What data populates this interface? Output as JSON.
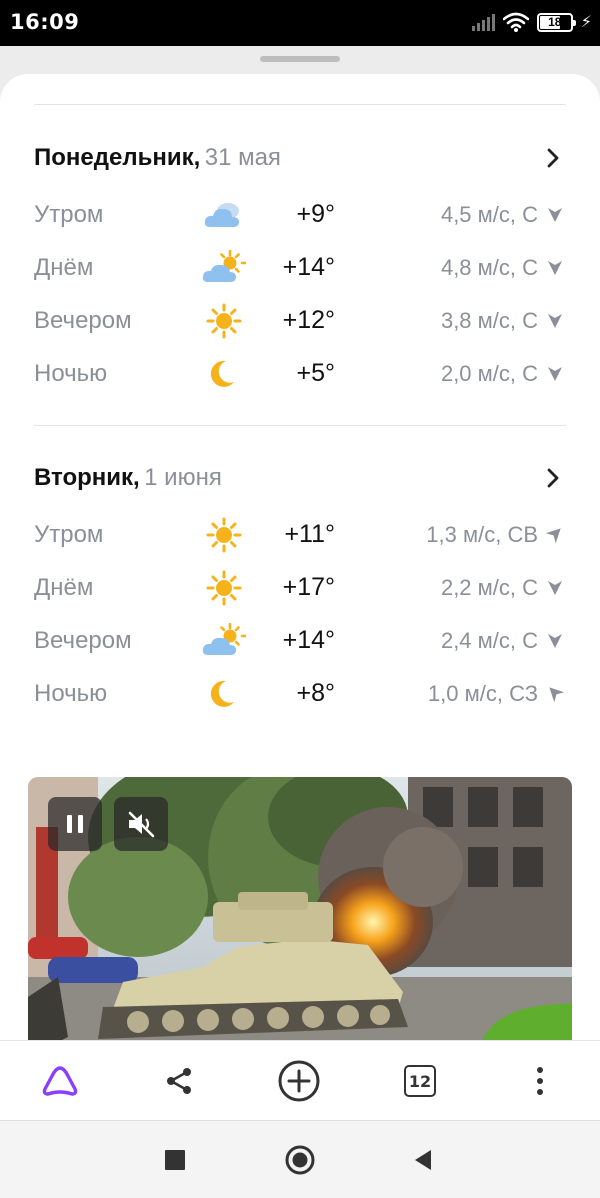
{
  "status_bar": {
    "time": "16:09",
    "battery": "18",
    "icons": [
      "signal-icon",
      "wifi-icon",
      "battery-icon",
      "charging-icon"
    ]
  },
  "forecast": {
    "days": [
      {
        "name": "Понедельник,",
        "date": "31 мая",
        "rows": [
          {
            "period": "Утром",
            "icon": "cloudy-icon",
            "temp": "+9°",
            "wind": "4,5 м/с, С",
            "wind_icon": "wind-arrow-icon"
          },
          {
            "period": "Днём",
            "icon": "partly-cloudy-icon",
            "temp": "+14°",
            "wind": "4,8 м/с, С",
            "wind_icon": "wind-arrow-icon"
          },
          {
            "period": "Вечером",
            "icon": "sun-icon",
            "temp": "+12°",
            "wind": "3,8 м/с, С",
            "wind_icon": "wind-arrow-icon"
          },
          {
            "period": "Ночью",
            "icon": "moon-icon",
            "temp": "+5°",
            "wind": "2,0 м/с, С",
            "wind_icon": "wind-arrow-icon"
          }
        ]
      },
      {
        "name": "Вторник,",
        "date": "1 июня",
        "rows": [
          {
            "period": "Утром",
            "icon": "sun-icon",
            "temp": "+11°",
            "wind": "1,3 м/с, СВ",
            "wind_icon": "wind-arrow-icon"
          },
          {
            "period": "Днём",
            "icon": "sun-icon",
            "temp": "+17°",
            "wind": "2,2 м/с, С",
            "wind_icon": "wind-arrow-icon"
          },
          {
            "period": "Вечером",
            "icon": "partly-cloudy-icon",
            "temp": "+14°",
            "wind": "2,4 м/с, С",
            "wind_icon": "wind-arrow-icon"
          },
          {
            "period": "Ночью",
            "icon": "moon-icon",
            "temp": "+8°",
            "wind": "1,0 м/с, СЗ",
            "wind_icon": "wind-arrow-icon"
          }
        ]
      }
    ]
  },
  "video": {
    "controls": [
      "pause-icon",
      "mute-icon"
    ]
  },
  "toolbar": {
    "tabs_count": "12",
    "items": [
      "alice-icon",
      "share-icon",
      "add-icon",
      "tabs-icon",
      "more-icon"
    ]
  },
  "colors": {
    "accent_alice": "#8a3ffc",
    "sun": "#f6b21b",
    "cloud": "#8fc1ef",
    "muted_text": "#8a8f99"
  }
}
